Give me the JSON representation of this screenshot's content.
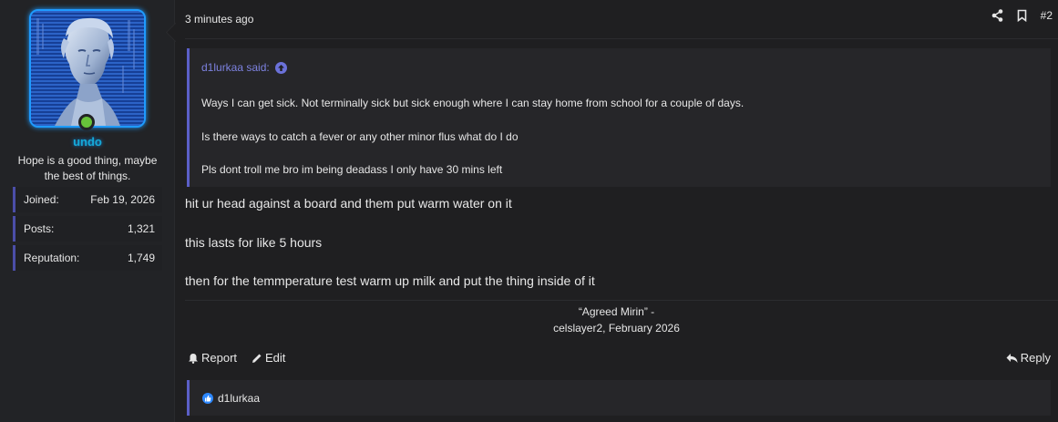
{
  "user": {
    "username": "undo",
    "title": "Hope is a good thing, maybe the best of things.",
    "stats": [
      {
        "label": "Joined:",
        "value": "Feb 19, 2026"
      },
      {
        "label": "Posts:",
        "value": "1,321"
      },
      {
        "label": "Reputation:",
        "value": "1,749"
      }
    ],
    "online": true,
    "avatar_icon": "statue-avatar"
  },
  "post": {
    "date": "3 minutes ago",
    "number": "#2",
    "header_icons": [
      "share-icon",
      "bookmark-icon"
    ],
    "quote": {
      "author_label": "d1lurkaa said:",
      "lines": [
        "Ways I can get sick. Not terminally sick but sick enough where I can stay home from school for a couple of days.",
        "Is there ways to catch a fever or any other minor flus what do I do",
        "Pls dont troll me bro im being deadass I only have 30 mins left"
      ]
    },
    "body": [
      "hit ur head against a board and them put warm water on it",
      "this lasts for like 5 hours",
      "then for the temmperature test warm up milk and put the thing inside of it"
    ],
    "signature": {
      "quote": "“Agreed Mirin” -",
      "attribution": "celslayer2, February 2026"
    },
    "actions": {
      "report": "Report",
      "edit": "Edit",
      "reply": "Reply"
    },
    "reactions": {
      "users": "d1lurkaa",
      "icon": "like-icon"
    }
  },
  "colors": {
    "accent": "#5b5fc7",
    "username": "#16a9d6",
    "online": "#67c23a",
    "avatar_border": "#1e9bff"
  }
}
